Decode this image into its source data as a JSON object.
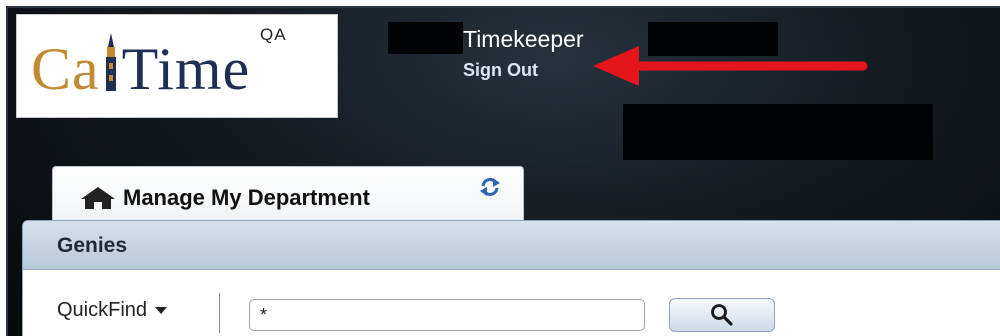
{
  "brand": {
    "logo_part1": "Ca",
    "logo_part2": "Time",
    "environment": "QA",
    "color_gold": "#c38a34",
    "color_navy": "#1e2f52"
  },
  "header": {
    "role": "Timekeeper",
    "signout_label": "Sign Out",
    "annotation_arrow_color": "#e4151b"
  },
  "tabs": [
    {
      "label": "Manage My Department",
      "icon": "home-icon",
      "action_icon": "refresh-icon"
    }
  ],
  "panel": {
    "title": "Genies",
    "quickfind_label": "QuickFind",
    "search_value": "*",
    "search_button_icon": "search-icon"
  }
}
